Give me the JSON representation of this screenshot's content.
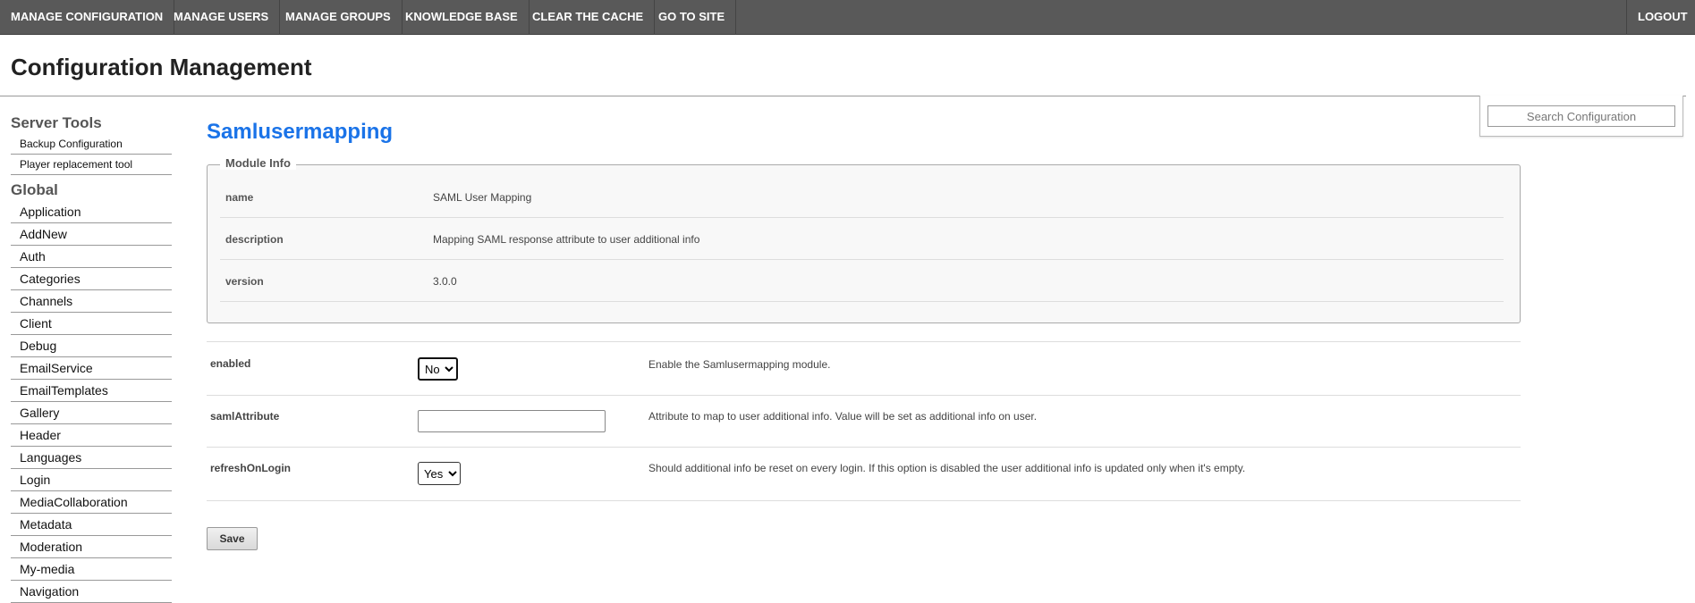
{
  "topnav": {
    "items": [
      "MANAGE CONFIGURATION",
      "MANAGE USERS",
      "MANAGE GROUPS",
      "KNOWLEDGE BASE",
      "CLEAR THE CACHE",
      "GO TO SITE"
    ],
    "logout": "LOGOUT"
  },
  "page": {
    "title": "Configuration Management"
  },
  "search": {
    "placeholder": "Search Configuration"
  },
  "sidebar": {
    "server_tools": {
      "heading": "Server Tools",
      "items": [
        "Backup Configuration",
        "Player replacement tool"
      ]
    },
    "global": {
      "heading": "Global",
      "items": [
        "Application",
        "AddNew",
        "Auth",
        "Categories",
        "Channels",
        "Client",
        "Debug",
        "EmailService",
        "EmailTemplates",
        "Gallery",
        "Header",
        "Languages",
        "Login",
        "MediaCollaboration",
        "Metadata",
        "Moderation",
        "My-media",
        "Navigation"
      ]
    }
  },
  "module": {
    "title": "Samlusermapping",
    "info_legend": "Module Info",
    "info": [
      {
        "key": "name",
        "value": "SAML User Mapping"
      },
      {
        "key": "description",
        "value": "Mapping SAML response attribute to user additional info"
      },
      {
        "key": "version",
        "value": "3.0.0"
      }
    ]
  },
  "settings": {
    "enabled": {
      "label": "enabled",
      "value": "No",
      "description": "Enable the Samlusermapping module."
    },
    "samlAttribute": {
      "label": "samlAttribute",
      "value": "",
      "description": "Attribute to map to user additional info. Value will be set as additional info on user."
    },
    "refreshOnLogin": {
      "label": "refreshOnLogin",
      "value": "Yes",
      "description": "Should additional info be reset on every login. If this option is disabled the user additional info is updated only when it's empty."
    }
  },
  "save_label": "Save",
  "colors": {
    "nav_bg": "#595959",
    "accent_title": "#1a73e8"
  }
}
